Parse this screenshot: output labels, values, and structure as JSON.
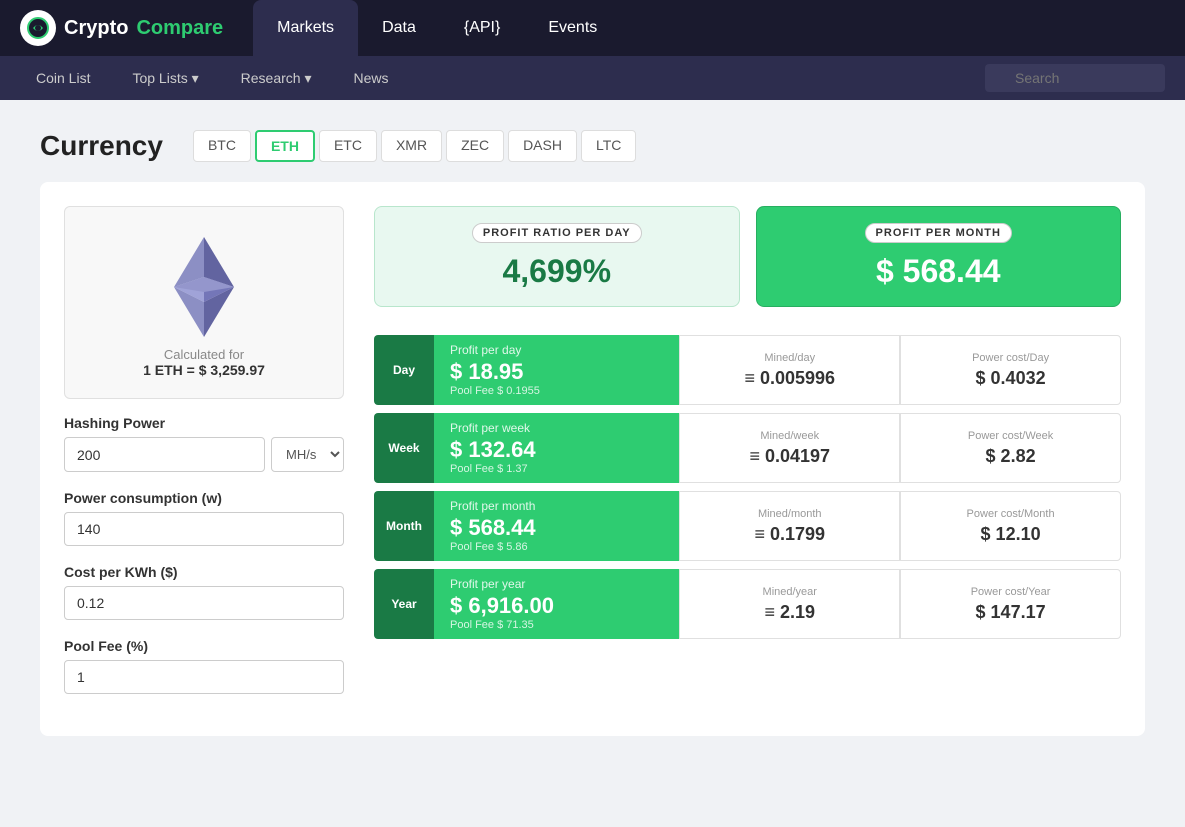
{
  "site": {
    "logo_text1": "Crypto",
    "logo_text2": "Compare"
  },
  "top_nav": {
    "items": [
      {
        "label": "Markets",
        "active": true
      },
      {
        "label": "Data",
        "active": false
      },
      {
        "label": "{API}",
        "active": false
      },
      {
        "label": "Events",
        "active": false
      }
    ]
  },
  "sub_nav": {
    "items": [
      {
        "label": "Coin List"
      },
      {
        "label": "Top Lists ▾"
      },
      {
        "label": "Research ▾"
      },
      {
        "label": "News"
      }
    ],
    "search_placeholder": "Search"
  },
  "page": {
    "title": "Currency",
    "tabs": [
      {
        "label": "BTC",
        "active": false
      },
      {
        "label": "ETH",
        "active": true
      },
      {
        "label": "ETC",
        "active": false
      },
      {
        "label": "XMR",
        "active": false
      },
      {
        "label": "ZEC",
        "active": false
      },
      {
        "label": "DASH",
        "active": false
      },
      {
        "label": "LTC",
        "active": false
      }
    ]
  },
  "eth_info": {
    "calc_label": "Calculated for",
    "calc_value": "1 ETH = $ 3,259.97"
  },
  "form": {
    "hashing_power_label": "Hashing Power",
    "hashing_power_value": "200",
    "hashing_unit": "MH/s",
    "power_consumption_label": "Power consumption (w)",
    "power_consumption_value": "140",
    "cost_per_kwh_label": "Cost per KWh ($)",
    "cost_per_kwh_value": "0.12",
    "pool_fee_label": "Pool Fee (%)",
    "pool_fee_value": "1"
  },
  "summary": {
    "profit_ratio_label": "PROFIT RATIO PER DAY",
    "profit_ratio_value": "4,699%",
    "profit_month_label": "PROFIT PER MONTH",
    "profit_month_value": "$ 568.44"
  },
  "rows": [
    {
      "period": "Day",
      "profit_title": "Profit per day",
      "profit_amount": "$ 18.95",
      "pool_fee": "Pool Fee $ 0.1955",
      "mined_title": "Mined/day",
      "mined_value": "≡ 0.005996",
      "power_title": "Power cost/Day",
      "power_value": "$ 0.4032"
    },
    {
      "period": "Week",
      "profit_title": "Profit per week",
      "profit_amount": "$ 132.64",
      "pool_fee": "Pool Fee $ 1.37",
      "mined_title": "Mined/week",
      "mined_value": "≡ 0.04197",
      "power_title": "Power cost/Week",
      "power_value": "$ 2.82"
    },
    {
      "period": "Month",
      "profit_title": "Profit per month",
      "profit_amount": "$ 568.44",
      "pool_fee": "Pool Fee $ 5.86",
      "mined_title": "Mined/month",
      "mined_value": "≡ 0.1799",
      "power_title": "Power cost/Month",
      "power_value": "$ 12.10"
    },
    {
      "period": "Year",
      "profit_title": "Profit per year",
      "profit_amount": "$ 6,916.00",
      "pool_fee": "Pool Fee $ 71.35",
      "mined_title": "Mined/year",
      "mined_value": "≡ 2.19",
      "power_title": "Power cost/Year",
      "power_value": "$ 147.17"
    }
  ]
}
